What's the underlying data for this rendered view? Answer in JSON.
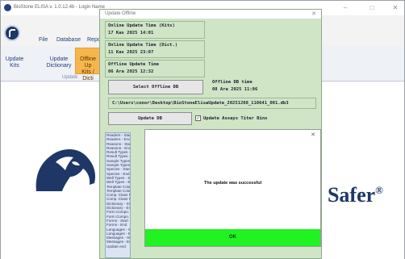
{
  "main_window": {
    "title": "BioStone ELISA v. 1.0.12.4b - Login Name",
    "menu": [
      "File",
      "Database",
      "Repo"
    ],
    "ribbon": {
      "buttons": [
        {
          "line1": "Update",
          "line2": "Kits"
        },
        {
          "line1": "Update",
          "line2": "Dictionary"
        },
        {
          "line1": "Offline Up",
          "line2": "Kits / Dicti"
        }
      ],
      "group_label": "Update"
    },
    "brand_text": "d Safer",
    "brand_mark": "®",
    "window_controls": [
      "–",
      "□",
      "✕"
    ]
  },
  "update_offline": {
    "title": "Update Offline",
    "online_kits_label": "Online Update Time (Kits)",
    "online_kits_value": "17 Kas 2025 14:01",
    "online_dict_label": "Online Update Time (Dict.)",
    "online_dict_value": "11 Kas 2025 23:07",
    "offline_update_label": "Offline Update Time",
    "offline_update_value": "06 Ara 2025 12:32",
    "select_db_button": "Select Offline DB",
    "offline_db_time_label": "Offline DB time",
    "offline_db_time_value": "08 Ara 2025 11:06",
    "db_path": "C:\\Users\\conor\\Desktop\\BioStoneElisaUpdate_20251208_110641_001.db3",
    "update_db_button": "Update DB",
    "update_assays_label": "Update Assays Titer Bins",
    "update_assays_checked": true,
    "log": [
      "Readers - Start",
      "Readers - End",
      "Reasons - Start",
      "Reasons - End",
      "Result Types - Start",
      "Result Types - End",
      "Sample Types - Start",
      "Sample Types - End",
      "Species - Start",
      "Species - End",
      "Well Types - Start",
      "Well Types - End",
      "Template Colors - St",
      "Template Colors - En",
      "Comp. Class Names",
      "Comp. Class Names",
      "Dictionary - Start",
      "Dictionary - End",
      "Form Compo. - Start",
      "Form Compo. - End",
      "Forms - Start",
      "Forms - End",
      "Languages - Start",
      "Languages - End",
      "Messages - Start",
      "Messages - End",
      "Update end"
    ]
  },
  "dialog": {
    "message": "The update was successful",
    "ok_label": "OK",
    "close": "✕"
  }
}
